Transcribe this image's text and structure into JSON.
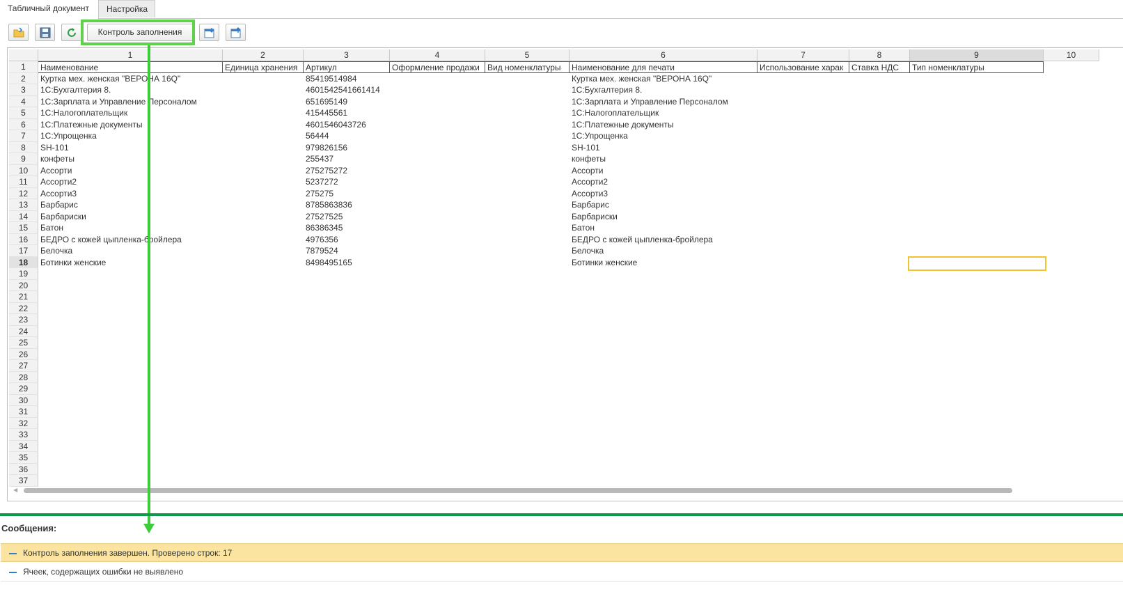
{
  "tabs": [
    "Табличный документ",
    "Настройка"
  ],
  "toolbar": {
    "open_icon": "folder-open-icon",
    "save_icon": "floppy-disk-icon",
    "refresh_icon": "refresh-icon",
    "control_label": "Контроль заполнения",
    "import_icon": "import-icon",
    "export_icon": "export-icon"
  },
  "sheet": {
    "col_numbers": [
      "1",
      "2",
      "3",
      "4",
      "5",
      "6",
      "7",
      "8",
      "9",
      "10"
    ],
    "headers": [
      "Наименование",
      "Единица хранения",
      "Артикул",
      "Оформление продажи",
      "Вид номенклатуры",
      "Наименование для печати",
      "Использование харак",
      "Ставка НДС",
      "Тип номенклатуры"
    ],
    "row_numbers": [
      "1",
      "2",
      "3",
      "4",
      "5",
      "6",
      "7",
      "8",
      "9",
      "10",
      "11",
      "12",
      "13",
      "14",
      "15",
      "16",
      "17",
      "18",
      "19",
      "20",
      "21",
      "22",
      "23",
      "24",
      "25",
      "26",
      "27",
      "28",
      "29",
      "30",
      "31",
      "32",
      "33",
      "34",
      "35",
      "36",
      "37"
    ],
    "rows": [
      {
        "name": " Куртка мех. женская \"ВЕРОНА 16Q\"",
        "article": "85419514984",
        "print_name": " Куртка мех. женская \"ВЕРОНА 16Q\""
      },
      {
        "name": "1С:Бухгалтерия 8.",
        "article": "4601542541661414",
        "print_name": "1С:Бухгалтерия 8."
      },
      {
        "name": "1С:Зарплата и Управление Персоналом",
        "article": "651695149",
        "print_name": "1С:Зарплата и Управление Персоналом"
      },
      {
        "name": "1С:Налогоплательщик",
        "article": "415445561",
        "print_name": "1С:Налогоплательщик"
      },
      {
        "name": "1С:Платежные документы",
        "article": "4601546043726",
        "print_name": "1С:Платежные документы"
      },
      {
        "name": "1С:Упрощенка",
        "article": "56444",
        "print_name": "1С:Упрощенка"
      },
      {
        "name": "SH-101",
        "article": "979826156",
        "print_name": "SH-101"
      },
      {
        "name": "конфеты",
        "article": "255437",
        "print_name": "конфеты"
      },
      {
        "name": "Ассорти",
        "article": "275275272",
        "print_name": "Ассорти"
      },
      {
        "name": "Ассорти2",
        "article": "5237272",
        "print_name": "Ассорти2"
      },
      {
        "name": "Ассорти3",
        "article": "275275",
        "print_name": "Ассорти3"
      },
      {
        "name": "Барбарис",
        "article": "8785863836",
        "print_name": "Барбарис"
      },
      {
        "name": "Барбариски",
        "article": "27527525",
        "print_name": "Барбариски"
      },
      {
        "name": "Батон",
        "article": "86386345",
        "print_name": "Батон"
      },
      {
        "name": "БЕДРО с кожей цыпленка-бройлера",
        "article": "4976356",
        "print_name": "БЕДРО с кожей цыпленка-бройлера"
      },
      {
        "name": "Белочка",
        "article": "7879524",
        "print_name": "Белочка"
      },
      {
        "name": "Ботинки женские",
        "article": "8498495165",
        "print_name": "Ботинки женские"
      }
    ],
    "selected_column": "9",
    "selected_row": "18"
  },
  "messages": {
    "title": "Сообщения:",
    "items": [
      "Контроль заполнения завершен. Проверено строк: 17",
      "Ячеек, содержащих ошибки не выявлено"
    ]
  },
  "colors": {
    "highlight": "#5fd14a",
    "separator": "#0e9a49",
    "message_highlight": "#fbe4a0",
    "active_cell": "#f2c233"
  }
}
